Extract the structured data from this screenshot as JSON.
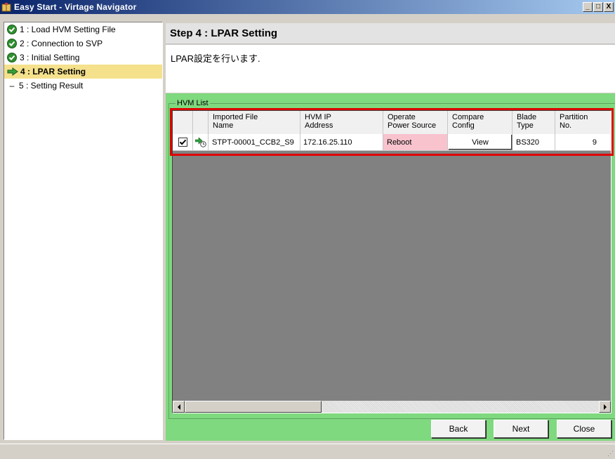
{
  "window": {
    "title": "Easy Start - Virtage Navigator",
    "controls": {
      "minimize": "_",
      "maximize": "□",
      "close": "X"
    }
  },
  "steps": [
    {
      "label": "1 : Load HVM Setting File",
      "status": "done",
      "icon": "check-icon"
    },
    {
      "label": "2 : Connection to SVP",
      "status": "done",
      "icon": "check-icon"
    },
    {
      "label": "3 : Initial Setting",
      "status": "done",
      "icon": "check-icon"
    },
    {
      "label": "4 : LPAR Setting",
      "status": "current",
      "icon": "arrow-right-icon"
    },
    {
      "label": "5 : Setting Result",
      "status": "pending",
      "icon": "dash-icon",
      "prefix": "–"
    }
  ],
  "main": {
    "step_title": "Step 4 : LPAR Setting",
    "description": "LPAR設定を行います.",
    "group_label": "HVM List"
  },
  "table": {
    "headers": [
      "Imported File Name",
      "HVM IP Address",
      "Operate Power Source",
      "Compare Config",
      "Blade Type",
      "Partition No."
    ],
    "header_lines": [
      [
        "Imported File",
        "Name"
      ],
      [
        "HVM IP",
        "Address"
      ],
      [
        "Operate",
        "Power Source"
      ],
      [
        "Compare",
        "Config"
      ],
      [
        "Blade",
        "Type"
      ],
      [
        "Partition",
        "No."
      ]
    ],
    "rows": [
      {
        "checked": true,
        "file_name": "STPT-00001_CCB2_S9",
        "ip": "172.16.25.110",
        "power": "Reboot",
        "compare": "View",
        "blade": "BS320",
        "partition": "9"
      }
    ]
  },
  "buttons": {
    "back": "Back",
    "next": "Next",
    "close": "Close"
  },
  "colors": {
    "panel_green": "#7fd97f",
    "highlight_red": "#e00000",
    "current_step": "#f5e18c",
    "reboot_pink": "#f8c3cd"
  }
}
